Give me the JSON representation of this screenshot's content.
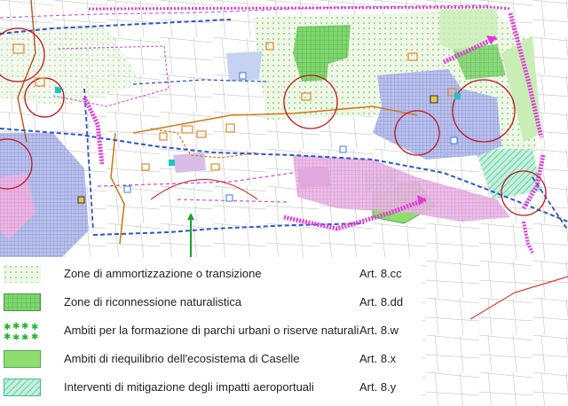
{
  "legend": {
    "items": [
      {
        "label": "Zone di ammortizzazione o transizione",
        "article": "Art. 8.cc",
        "swatch": "dots-pattern-icon"
      },
      {
        "label": "Zone di riconnessione naturalistica",
        "article": "Art. 8.dd",
        "swatch": "grid-pattern-icon"
      },
      {
        "label": "Ambiti per la formazione di parchi urbani o riserve naturali",
        "article": "Art. 8.w",
        "swatch": "star-border-pattern-icon"
      },
      {
        "label": "Ambiti di riequilibrio dell'ecosistema di Caselle",
        "article": "Art. 8.x",
        "swatch": "solid-green-pattern-icon"
      },
      {
        "label": "Interventi di mitigazione degli impatti aeroportuali",
        "article": "Art. 8.y",
        "swatch": "hatched-pattern-icon"
      }
    ]
  },
  "colors": {
    "light_green_zone": "#dff0cf",
    "grid_green_zone": "#6ccf63",
    "solid_green_zone": "#8fdc6f",
    "hatched_green_zone": "#a9e7c8",
    "urban_blue": "#a8b2e6",
    "urban_pink": "#e7a6e0",
    "magenta_arrow": "#e23ad8",
    "blue_dashed_road": "#2e55c8",
    "red_circle": "#c0161c",
    "orange_boundary": "#d07a1e",
    "purple_dashed_boundary": "#c655d8",
    "railway_red": "#d43a3a",
    "green_star_border": "#22b52d"
  }
}
